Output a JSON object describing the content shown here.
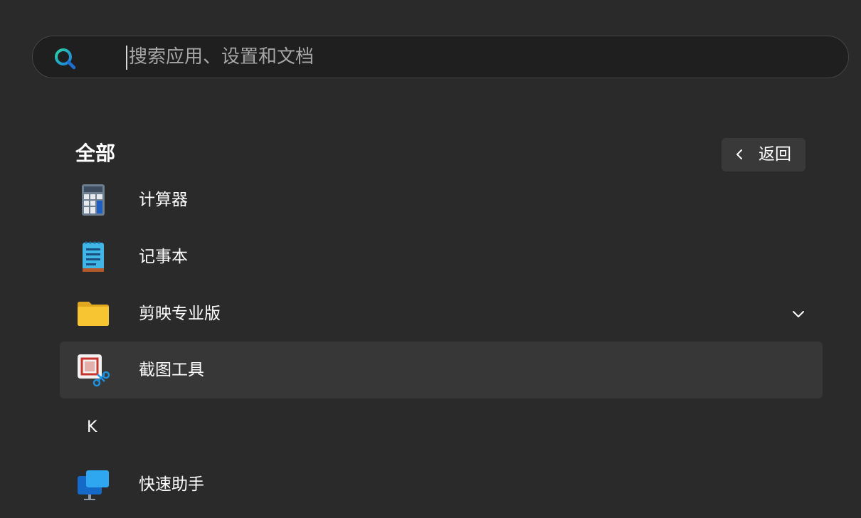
{
  "search": {
    "placeholder": "搜索应用、设置和文档",
    "value": ""
  },
  "section": {
    "title": "全部"
  },
  "back_button": {
    "label": "返回",
    "icon": "chevron-left-icon"
  },
  "apps": [
    {
      "label": "计算器",
      "icon": "calculator-icon"
    },
    {
      "label": "记事本",
      "icon": "notepad-icon"
    },
    {
      "label": "剪映专业版",
      "icon": "folder-icon",
      "expandable": true
    },
    {
      "label": "截图工具",
      "icon": "snipping-tool-icon",
      "selected": true
    }
  ],
  "letter_header": "K",
  "apps_k": [
    {
      "label": "快速助手",
      "icon": "quick-assist-icon"
    }
  ],
  "colors": {
    "background": "#2a2a2b",
    "search_background": "#1f1f20",
    "selected_item": "#373738",
    "button_background": "#393939",
    "folder_yellow": "#f7c531",
    "accent_blue": "#1e90e0"
  }
}
